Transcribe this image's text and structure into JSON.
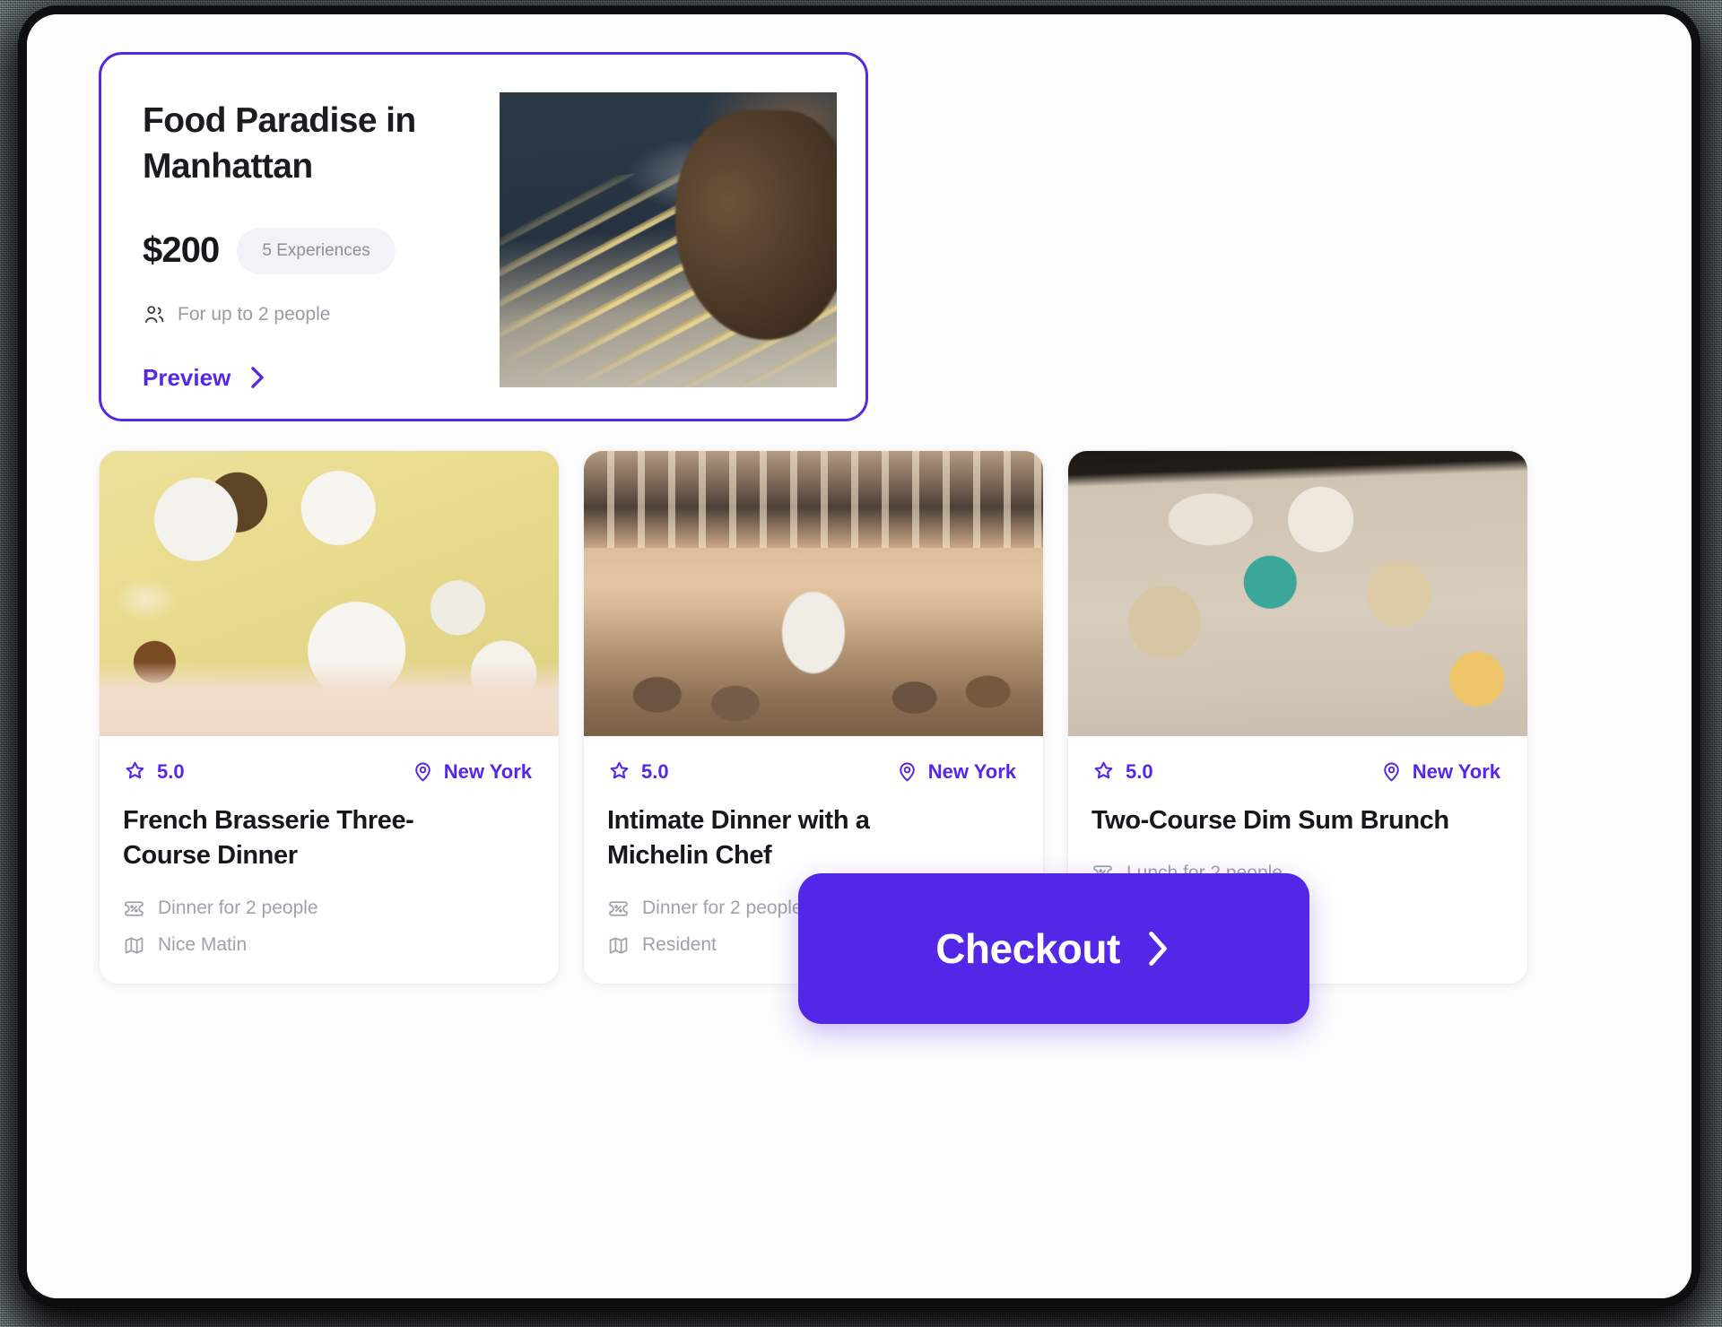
{
  "theme": {
    "accent": "#5726e6",
    "checkout_bg": "#5227e8",
    "muted_text": "#a0a2aa",
    "title_text": "#17171c",
    "badge_bg": "#f2f3f6"
  },
  "hero": {
    "title": "Food Paradise in Manhattan",
    "price": "$200",
    "experiences_badge": "5 Experiences",
    "capacity": "For up to 2 people",
    "preview_label": "Preview",
    "people_icon": "users-icon",
    "chevron_icon": "chevron-right-icon",
    "image_alt": "chef-hands-fresh-pasta"
  },
  "cards": [
    {
      "rating": "5.0",
      "location": "New York",
      "title": "French Brasserie Three-Course Dinner",
      "meal": "Dinner for 2 people",
      "venue": "Nice Matin",
      "rating_icon": "star-icon",
      "location_icon": "map-pin-icon",
      "meal_icon": "ticket-percent-icon",
      "venue_icon": "map-icon",
      "image_alt": "overhead-table-seafood-plates"
    },
    {
      "rating": "5.0",
      "location": "New York",
      "title": "Intimate Dinner with a Michelin Chef",
      "meal": "Dinner for 2 people",
      "venue": "Resident",
      "rating_icon": "star-icon",
      "location_icon": "map-pin-icon",
      "meal_icon": "ticket-percent-icon",
      "venue_icon": "map-icon",
      "image_alt": "restaurant-dining-room-interior"
    },
    {
      "rating": "5.0",
      "location": "New York",
      "title": "Two-Course Dim Sum Brunch",
      "meal": "Lunch for 2 people",
      "venue": "",
      "rating_icon": "star-icon",
      "location_icon": "map-pin-icon",
      "meal_icon": "ticket-percent-icon",
      "venue_icon": "map-icon",
      "image_alt": "dim-sum-bamboo-steamers"
    }
  ],
  "checkout": {
    "label": "Checkout",
    "icon": "chevron-right-icon"
  }
}
